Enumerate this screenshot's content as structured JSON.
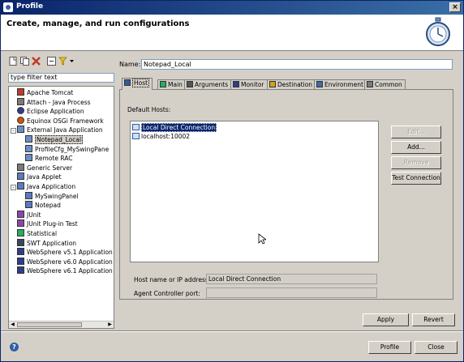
{
  "window": {
    "title": "Profile"
  },
  "header": {
    "title": "Create, manage, and run configurations"
  },
  "sidebar": {
    "filter_placeholder": "type filter text",
    "tree": [
      {
        "label": "Apache Tomcat",
        "indent": 1,
        "icon": "tomcat-icon",
        "color": "#c0392b"
      },
      {
        "label": "Attach - Java Process",
        "indent": 1,
        "icon": "attach-icon",
        "color": "#7a7a7a"
      },
      {
        "label": "Eclipse Application",
        "indent": 1,
        "icon": "eclipse-icon",
        "color": "#2c3e8c"
      },
      {
        "label": "Equinox OSGi Framework",
        "indent": 1,
        "icon": "osgi-icon",
        "color": "#d35400"
      },
      {
        "label": "External Java Application",
        "indent": 0,
        "expander": "-",
        "icon": "java-app-icon",
        "color": "#6b8fc7"
      },
      {
        "label": "Notepad_Local",
        "indent": 2,
        "icon": "config-icon",
        "color": "#6b8fc7",
        "selected": true
      },
      {
        "label": "ProfileCfg_MySwingPane",
        "indent": 2,
        "icon": "config-icon",
        "color": "#6b8fc7"
      },
      {
        "label": "Remote RAC",
        "indent": 2,
        "icon": "config-icon",
        "color": "#6b8fc7"
      },
      {
        "label": "Generic Server",
        "indent": 1,
        "icon": "server-icon",
        "color": "#7a7a7a"
      },
      {
        "label": "Java Applet",
        "indent": 1,
        "icon": "applet-icon",
        "color": "#5a7bbf"
      },
      {
        "label": "Java Application",
        "indent": 0,
        "expander": "-",
        "icon": "java-app-icon",
        "color": "#5a7bbf"
      },
      {
        "label": "MySwingPanel",
        "indent": 2,
        "icon": "config-icon",
        "color": "#5a7bbf"
      },
      {
        "label": "Notepad",
        "indent": 2,
        "icon": "config-icon",
        "color": "#5a7bbf"
      },
      {
        "label": "JUnit",
        "indent": 1,
        "icon": "junit-icon",
        "color": "#8e44ad"
      },
      {
        "label": "JUnit Plug-in Test",
        "indent": 1,
        "icon": "junit-plugin-icon",
        "color": "#8e44ad"
      },
      {
        "label": "Statistical",
        "indent": 1,
        "icon": "statistical-icon",
        "color": "#27ae60"
      },
      {
        "label": "SWT Application",
        "indent": 1,
        "icon": "swt-icon",
        "color": "#34495e"
      },
      {
        "label": "WebSphere v5.1 Application",
        "indent": 1,
        "icon": "websphere-icon",
        "color": "#2c3e8c"
      },
      {
        "label": "WebSphere v6.0 Application",
        "indent": 1,
        "icon": "websphere-icon",
        "color": "#2c3e8c"
      },
      {
        "label": "WebSphere v6.1 Application",
        "indent": 1,
        "icon": "websphere-icon",
        "color": "#2c3e8c"
      }
    ]
  },
  "config": {
    "name_label": "Name:",
    "name_value": "Notepad_Local",
    "tabs": [
      {
        "label": "Host",
        "icon": "host-icon",
        "active": true
      },
      {
        "label": "Main",
        "icon": "main-icon"
      },
      {
        "label": "Arguments",
        "icon": "arguments-icon"
      },
      {
        "label": "Monitor",
        "icon": "monitor-icon"
      },
      {
        "label": "Destination",
        "icon": "destination-icon"
      },
      {
        "label": "Environment",
        "icon": "environment-icon"
      },
      {
        "label": "Common",
        "icon": "common-icon"
      }
    ],
    "default_hosts_label": "Default Hosts:",
    "hosts": [
      {
        "label": "Local Direct Connection",
        "selected": true
      },
      {
        "label": "localhost:10002"
      }
    ],
    "buttons": {
      "edit": "Edit...",
      "add": "Add...",
      "remove": "Remove",
      "test": "Test Connection"
    },
    "host_ip_label": "Host name or IP address:",
    "host_ip_value": "Local Direct Connection",
    "agent_port_label": "Agent Controller port:",
    "agent_port_value": "",
    "apply": "Apply",
    "revert": "Revert"
  },
  "footer": {
    "profile": "Profile",
    "close": "Close"
  }
}
